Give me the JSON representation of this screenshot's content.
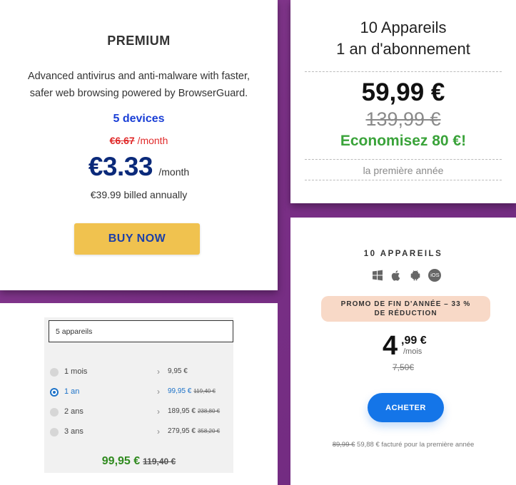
{
  "premium": {
    "title": "PREMIUM",
    "description_line1": "Advanced antivirus and anti-malware with faster,",
    "description_line2": "safer web browsing powered by BrowserGuard.",
    "devices": "5 devices",
    "old_price": "€6.67",
    "old_price_period": " /month",
    "price": "€3.33",
    "price_period": "/month",
    "billed": "€39.99 billed annually",
    "buy_label": "BUY NOW",
    "colors": {
      "accent_blue": "#1a3fd6",
      "button": "#f0c24f",
      "old_price": "#e02a2a"
    }
  },
  "offer_10_1an": {
    "title_line1": "10 Appareils",
    "title_line2": "1 an d'abonnement",
    "price": "59,99 €",
    "old_price": "139,99 €",
    "savings": "Economisez 80 €!",
    "period_note": "la première année",
    "colors": {
      "savings": "#3aa33a"
    }
  },
  "selector": {
    "device_select_value": "5 appareils",
    "options": [
      {
        "label": "1 mois",
        "price": "9,95 €",
        "old": "",
        "selected": false
      },
      {
        "label": "1 an",
        "price": "99,95 €",
        "old": "119,40 €",
        "selected": true
      },
      {
        "label": "2 ans",
        "price": "189,95 €",
        "old": "238,80 €",
        "selected": false
      },
      {
        "label": "3 ans",
        "price": "279,95 €",
        "old": "358,20 €",
        "selected": false
      }
    ],
    "total_price": "99,95 €",
    "total_old": "119,40 €",
    "colors": {
      "selected": "#1e73c8",
      "total": "#2f8a1e"
    }
  },
  "offer_10_promo": {
    "title": "10 APPAREILS",
    "platform_icons": [
      "windows-icon",
      "apple-icon",
      "android-icon",
      "ios-icon"
    ],
    "ios_label": "iOS",
    "promo_line1": "PROMO DE FIN D'ANNÉE – 33 %",
    "promo_line2": "DE RÉDUCTION",
    "price_int": "4",
    "price_dec": ",99 €",
    "price_period": "/mois",
    "old_price": "7,50€",
    "buy_label": "ACHETER",
    "footer_old": "89,99 €",
    "footer_text": " 59,88 € facturé pour la première année",
    "colors": {
      "button": "#1475e8",
      "promo_bg": "#f8d9c7"
    }
  }
}
